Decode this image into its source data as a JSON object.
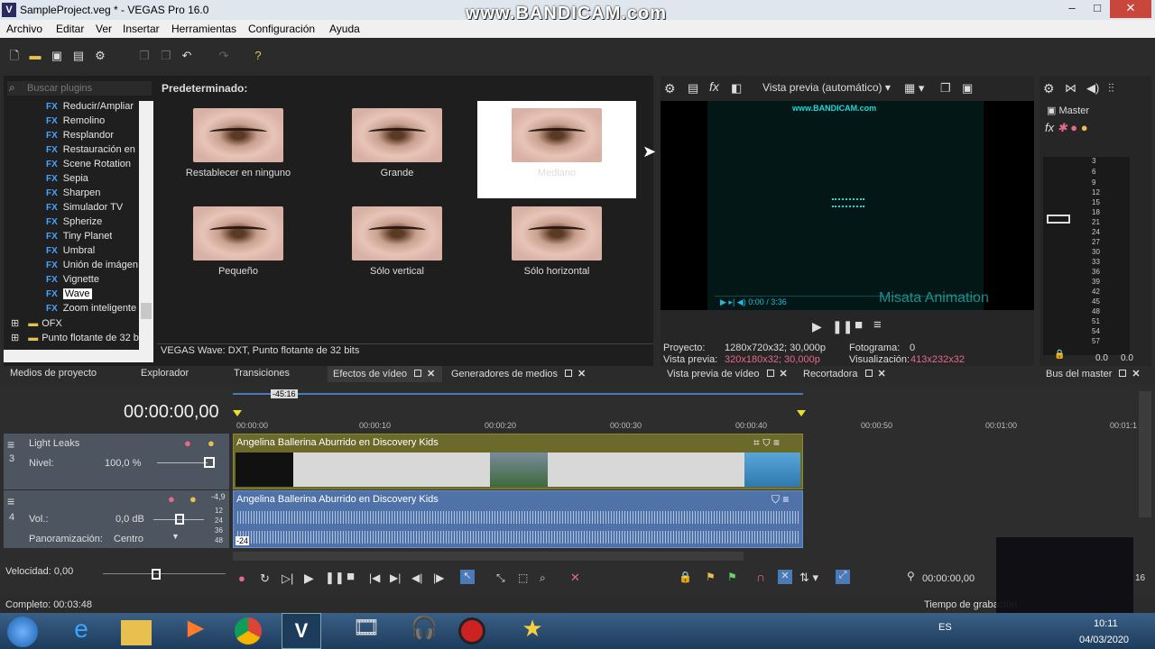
{
  "window": {
    "title": "SampleProject.veg * - VEGAS Pro 16.0",
    "logo": "V",
    "watermark": "www.BANDICAM.com",
    "min": "–",
    "max": "□",
    "close": "✕"
  },
  "menu": [
    "Archivo",
    "Editar",
    "Ver",
    "Insertar",
    "Herramientas",
    "Configuración",
    "Ayuda"
  ],
  "plugins": {
    "search_placeholder": "Buscar plugins",
    "header": "Predeterminado:",
    "tree": [
      "Reducir/Ampliar",
      "Remolino",
      "Resplandor",
      "Restauración en r",
      "Scene Rotation",
      "Sepia",
      "Sharpen",
      "Simulador TV",
      "Spherize",
      "Tiny Planet",
      "Umbral",
      "Unión de imágene",
      "Vignette",
      "Wave",
      "Zoom inteligente d"
    ],
    "fx_tag": "FX",
    "folders": [
      "OFX",
      "Punto flotante de 32 b"
    ],
    "presets": [
      "Restablecer en ninguno",
      "Grande",
      "Mediano",
      "Pequeño",
      "Sólo vertical",
      "Sólo horizontal"
    ],
    "status": "VEGAS Wave: DXT, Punto flotante de 32 bits"
  },
  "preview": {
    "mode": "Vista previa (automático)",
    "inner_watermark": "www.BANDICAM.com",
    "overlay_text": "Misata Animation",
    "inner_time": "0:00 / 3:36",
    "proyecto_label": "Proyecto:",
    "proyecto_value": "1280x720x32; 30,000p",
    "fotograma_label": "Fotograma:",
    "fotograma_value": "0",
    "vista_label": "Vista previa:",
    "vista_value": "320x180x32; 30,000p",
    "visualizacion_label": "Visualización:",
    "visualizacion_value": "413x232x32"
  },
  "master": {
    "label": "Master",
    "scale": [
      "3",
      "6",
      "9",
      "12",
      "15",
      "18",
      "21",
      "24",
      "27",
      "30",
      "33",
      "36",
      "39",
      "42",
      "45",
      "48",
      "51",
      "54",
      "57"
    ],
    "left_val": "0.0",
    "right_val": "0.0"
  },
  "tabs_left": [
    "Medios de proyecto",
    "Explorador",
    "Transiciones",
    "Efectos de vídeo",
    "Generadores de medios"
  ],
  "tabs_mid": [
    "Vista previa de vídeo",
    "Recortadora"
  ],
  "tabs_right": [
    "Bus del master"
  ],
  "timeline": {
    "timecode": "00:00:00,00",
    "marker": "-45:16",
    "ruler": [
      "00:00:00",
      "00:00:10",
      "00:00:20",
      "00:00:30",
      "00:00:40",
      "00:00:50",
      "00:01:00",
      "00:01:1"
    ],
    "video_track": {
      "name": "Light Leaks",
      "num": "3",
      "nivel_label": "Nivel:",
      "nivel_value": "100,0 %",
      "clip_title": "Angelina Ballerina Aburrido en Discovery Kids"
    },
    "audio_track": {
      "num": "4",
      "vol_label": "Vol.:",
      "vol_value": "0,0 dB",
      "pan_label": "Panoramización:",
      "pan_value": "Centro",
      "clip_title": "Angelina Ballerina Aburrido en Discovery Kids",
      "peak": "-4,9",
      "meter": [
        "12",
        "24",
        "36",
        "48"
      ],
      "clip_db": "-24"
    },
    "velocidad": "Velocidad: 0,00",
    "transport_time": "00:00:00,00",
    "right_num": "16"
  },
  "status": {
    "completo": "Completo: 00:03:48",
    "tiempo": "Tiempo de grabación"
  },
  "taskbar": {
    "lang": "ES",
    "time": "10:11",
    "date": "04/03/2020"
  }
}
